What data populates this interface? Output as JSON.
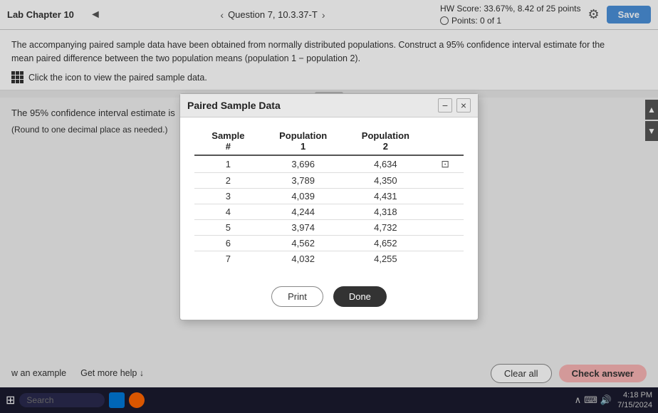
{
  "header": {
    "tab_label": "Lab Chapter 10",
    "question_label": "Question 7, 10.3.37-T",
    "hw_score_label": "HW Score: 33.67%, 8.42 of 25 points",
    "points_label": "Points: 0 of 1",
    "save_label": "Save",
    "chevron_left": "‹",
    "chevron_right": "›"
  },
  "problem": {
    "text": "The accompanying paired sample data have been obtained from normally distributed populations. Construct a 95% confidence interval estimate for the mean paired difference between the two population means (population 1 − population 2).",
    "click_text": "Click the icon to view the paired sample data."
  },
  "answer": {
    "label": "The 95% confidence interval estimate is",
    "box1_placeholder": "",
    "separator": "−",
    "box2_placeholder": "",
    "round_note": "(Round to one decimal place as needed.)"
  },
  "modal": {
    "title": "Paired Sample Data",
    "minimize_label": "−",
    "close_label": "×",
    "table": {
      "headers": [
        "Sample #",
        "Population 1",
        "Population 2"
      ],
      "rows": [
        [
          "1",
          "3,696",
          "4,634"
        ],
        [
          "2",
          "3,789",
          "4,350"
        ],
        [
          "3",
          "4,039",
          "4,431"
        ],
        [
          "4",
          "4,244",
          "4,318"
        ],
        [
          "5",
          "3,974",
          "4,732"
        ],
        [
          "6",
          "4,562",
          "4,652"
        ],
        [
          "7",
          "4,032",
          "4,255"
        ]
      ]
    },
    "print_label": "Print",
    "done_label": "Done"
  },
  "bottom": {
    "example_label": "w an example",
    "help_label": "Get more help ↓",
    "clear_label": "Clear all",
    "check_label": "Check answer"
  },
  "taskbar": {
    "search_placeholder": "Search",
    "time": "4:18 PM",
    "date": "7/15/2024"
  }
}
